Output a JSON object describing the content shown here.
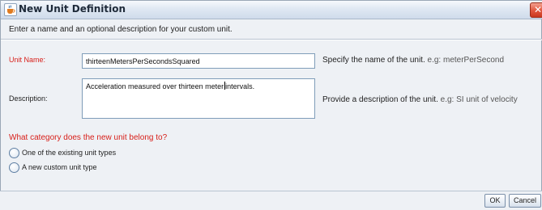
{
  "window": {
    "title": "New Unit Definition",
    "close_glyph": "✕",
    "icon": "java-cup-icon"
  },
  "intro": "Enter a name and an optional description for your custom unit.",
  "unit_name": {
    "label": "Unit Name:",
    "value": "thirteenMetersPerSecondsSquared",
    "hint": "Specify the name of the unit.",
    "hint_example": "e.g: meterPerSecond"
  },
  "description": {
    "label": "Description:",
    "value_before_caret": "Acceleration measured over thirteen meter",
    "value_after_caret": "intervals.",
    "hint": "Provide a description of the unit.",
    "hint_example": "e.g: SI unit of velocity"
  },
  "category": {
    "question": "What category does the new unit belong to?",
    "options": [
      {
        "label": "One of the existing unit types",
        "selected": false
      },
      {
        "label": "A new custom unit type",
        "selected": false
      }
    ]
  },
  "buttons": {
    "ok": "OK",
    "cancel": "Cancel"
  },
  "colors": {
    "required_label": "#d8201a",
    "dialog_background": "#eef1f5",
    "field_border": "#7f9db9"
  }
}
